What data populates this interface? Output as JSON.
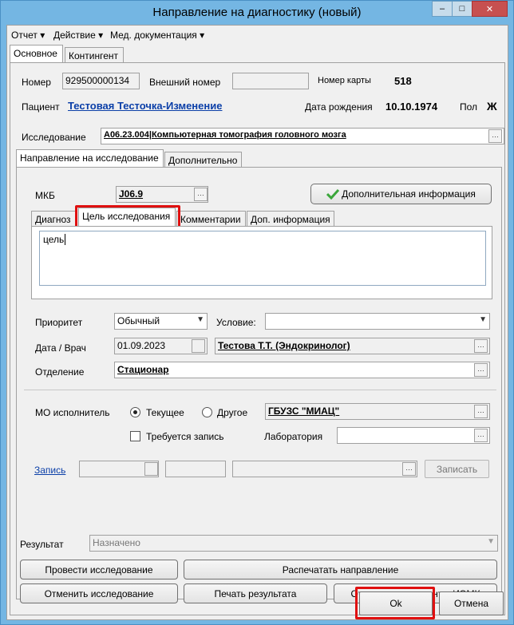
{
  "window": {
    "title": "Направление на диагностику (новый)",
    "minimize": "–",
    "maximize": "□",
    "close": "✕"
  },
  "menu": {
    "items": [
      "Отчет ▾",
      "Действие ▾",
      "Мед. документация ▾"
    ]
  },
  "top_tabs": [
    "Основное",
    "Контингент"
  ],
  "patient": {
    "number_label": "Номер",
    "number_value": "929500000134",
    "ext_number_label": "Внешний номер",
    "ext_number_value": "",
    "card_label": "Номер карты",
    "card_value": "518",
    "patient_label": "Пациент",
    "patient_name": "Тестовая Тесточка-Изменение",
    "birth_label": "Дата рождения",
    "birth_value": "10.10.1974",
    "sex_label": "Пол",
    "sex_value": "Ж"
  },
  "study": {
    "label": "Исследование",
    "value": "A06.23.004|Компьютерная томография головного мозга"
  },
  "section_tabs": [
    "Направление на исследование",
    "Дополнительно"
  ],
  "direction": {
    "mkb_label": "МКБ",
    "mkb_value": "J06.9",
    "extra_info_button": "Дополнительная информация",
    "sub_tabs": [
      "Диагноз",
      "Цель исследования",
      "Комментарии",
      "Доп. информация"
    ],
    "goal_text": "цель",
    "priority_label": "Приоритет",
    "priority_value": "Обычный",
    "condition_label": "Условие:",
    "condition_value": "",
    "date_doctor_label": "Дата / Врач",
    "date_value": "01.09.2023",
    "doctor_value": "Тестова Т.Т. (Эндокринолог)",
    "department_label": "Отделение",
    "department_value": "Стационар",
    "mo_label": "МО исполнитель",
    "radio_current": "Текущее",
    "radio_other": "Другое",
    "mo_value": "ГБУЗС \"МИАЦ\"",
    "record_required_label": "Требуется запись",
    "laboratory_label": "Лаборатория",
    "laboratory_value": "",
    "record_link": "Запись",
    "record_button": "Записать"
  },
  "result": {
    "label": "Результат",
    "value": "Назначено"
  },
  "actions": {
    "conduct": "Провести исследование",
    "print_direction": "Распечатать направление",
    "cancel_study": "Отменить исследование",
    "print_result": "Печать результата",
    "send_iemk": "Отправить документ в ИЭМК"
  },
  "dialog": {
    "ok": "Ok",
    "cancel": "Отмена"
  },
  "colors": {
    "title_bar": "#74b6e3",
    "highlight": "#e01010",
    "link": "#0b3fa8",
    "check_green": "#3aa63a"
  }
}
